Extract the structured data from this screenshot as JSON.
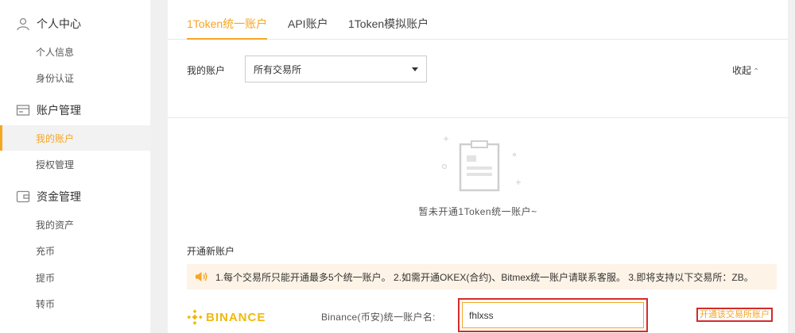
{
  "sidebar": {
    "groups": [
      {
        "title": "个人中心",
        "icon": "user-icon",
        "items": [
          {
            "label": "个人信息"
          },
          {
            "label": "身份认证"
          }
        ]
      },
      {
        "title": "账户管理",
        "icon": "account-card-icon",
        "items": [
          {
            "label": "我的账户",
            "active": true
          },
          {
            "label": "授权管理"
          }
        ]
      },
      {
        "title": "资金管理",
        "icon": "wallet-icon",
        "items": [
          {
            "label": "我的资产"
          },
          {
            "label": "充币"
          },
          {
            "label": "提币"
          },
          {
            "label": "转币"
          }
        ]
      }
    ]
  },
  "tabs": [
    {
      "label": "1Token统一账户",
      "active": true
    },
    {
      "label": "API账户"
    },
    {
      "label": "1Token模拟账户"
    }
  ],
  "filter": {
    "label": "我的账户",
    "select_value": "所有交易所",
    "collapse_label": "收起"
  },
  "empty": {
    "text": "暂未开通1Token统一账户~"
  },
  "open_section": {
    "title": "开通新账户",
    "notice": "1.每个交易所只能开通最多5个统一账户。 2.如需开通OKEX(合约)、Bitmex统一账户请联系客服。 3.即将支持以下交易所：ZB。",
    "exchange": {
      "logo_text": "BINANCE",
      "account_label": "Binance(币安)统一账户名:",
      "input_value": "fhlxss",
      "open_link": "开通该交易所账户"
    }
  },
  "colors": {
    "accent": "#f5a623",
    "highlight_border": "#d42b2b",
    "binance": "#f0b90b",
    "notice_bg": "#fdf3e6"
  }
}
